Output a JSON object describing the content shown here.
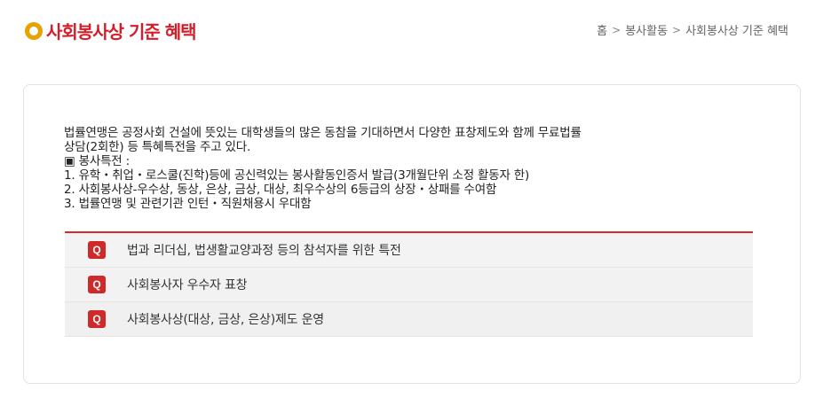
{
  "page": {
    "title": "사회봉사상 기준 혜택",
    "title_icon": "circle-bullet-icon"
  },
  "breadcrumb": {
    "items": [
      "홈",
      "봉사활동",
      "사회봉사상 기준 혜택"
    ],
    "separator": ">"
  },
  "intro": {
    "lines": [
      "법률연맹은 공정사회 건설에 뜻있는 대학생들의 많은 동참을 기대하면서 다양한 표창제도와 함께 무료법률",
      "상담(2회한) 등 특혜특전을 주고 있다.",
      "▣ 봉사특전 :",
      "1. 유학・취업・로스쿨(진학)등에 공신력있는 봉사활동인증서 발급(3개월단위 소정 활동자 한)",
      "2. 사회봉사상-우수상, 동상, 은상, 금상, 대상, 최우수상의 6등급의 상장・상패를 수여함",
      "3. 법률연맹 및 관련기관 인턴・직원채용시 우대함"
    ]
  },
  "faq": {
    "badge": "Q",
    "items": [
      "법과 리더십, 법생활교양과정 등의 참석자를 위한 특전",
      "사회봉사자 우수자 표창",
      "사회봉사상(대상, 금상, 은상)제도 운영"
    ]
  },
  "colors": {
    "title": "#d51d2a",
    "icon": "#e8a200",
    "accent": "#d52b2b",
    "badge": "#cf2a2a"
  }
}
